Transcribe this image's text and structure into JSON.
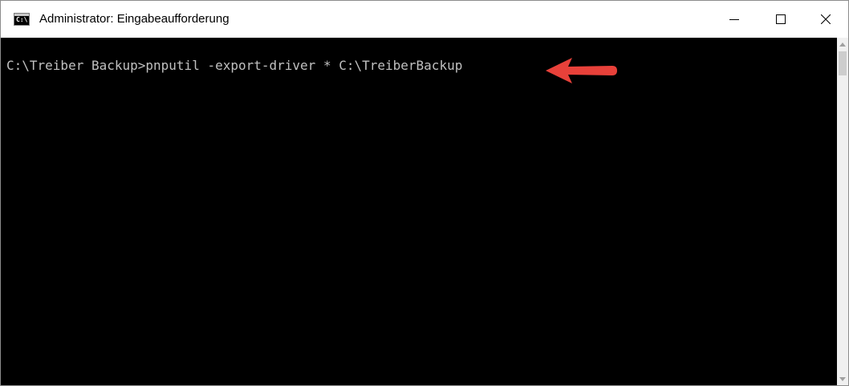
{
  "window": {
    "title": "Administrator: Eingabeaufforderung",
    "icon": "cmd-icon",
    "icon_text": "C:\\",
    "buttons": {
      "minimize": "minimize-icon",
      "maximize": "maximize-icon",
      "close": "close-icon"
    }
  },
  "console": {
    "background": "#000000",
    "text_color": "#c0c0c0",
    "lines": [
      "C:\\Treiber Backup>pnputil -export-driver * C:\\TreiberBackup"
    ]
  },
  "annotation": {
    "icon": "red-arrow-left-icon",
    "color": "#e8413a"
  }
}
